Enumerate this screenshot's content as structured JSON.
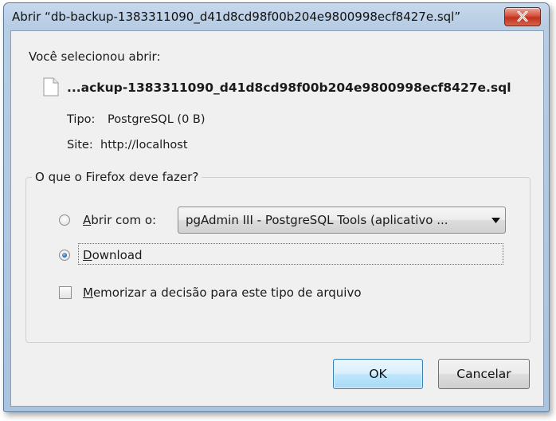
{
  "window": {
    "title": "Abrir “db-backup-1383311090_d41d8cd98f00b204e9800998ecf8427e.sql”"
  },
  "dialog": {
    "prompt": "Você selecionou abrir:",
    "filename": "...ackup-1383311090_d41d8cd98f00b204e9800998ecf8427e.sql",
    "type_label": "Tipo:",
    "type_value": "PostgreSQL (0 B)",
    "site_label": "Site:",
    "site_value": "http://localhost"
  },
  "action_group": {
    "legend": "O que o Firefox deve fazer?",
    "open_with": {
      "label_underlined": "A",
      "label_rest": "brir com o:",
      "selected": false,
      "app_selected": "pgAdmin III - PostgreSQL Tools (aplicativo ..."
    },
    "download": {
      "label_underlined": "D",
      "label_rest": "ownload",
      "selected": true
    },
    "remember": {
      "label_underlined": "M",
      "label_rest": "emorizar a decisão para este tipo de arquivo",
      "checked": false
    }
  },
  "buttons": {
    "ok": "OK",
    "cancel": "Cancelar"
  },
  "icons": {
    "close": "close-icon",
    "file": "file-icon",
    "dropdown": "chevron-down-icon"
  }
}
